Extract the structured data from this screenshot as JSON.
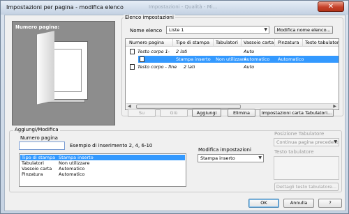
{
  "window": {
    "title": "Impostazioni per pagina - modifica elenco",
    "background_title": "Impostazioni - Qualità - Mi...",
    "close_glyph": "✕"
  },
  "preview": {
    "label": "Numero pagina:"
  },
  "elenco": {
    "group_label": "Elenco impostazioni",
    "nome_label": "Nome elenco",
    "nome_value": "Liste 1",
    "modifica_nome_button": "Modifica nome elenco...",
    "columns": [
      "Numero pagina",
      "Tipo di stampa",
      "Tabulatori",
      "Vassoio carta",
      "Pinzatura",
      "Testo tabulatore"
    ],
    "rows": [
      {
        "numero": "Testo corpo 1-",
        "tipo": "2 lati",
        "tab": "",
        "vassoio": "Auto",
        "pinz": "",
        "testo": "",
        "italic": true,
        "selected": false,
        "indent": 0
      },
      {
        "numero": "",
        "tipo": "Stampa inserto",
        "tab": "Non utilizzare",
        "vassoio": "Automatico",
        "pinz": "Automatico",
        "testo": "",
        "italic": false,
        "selected": true,
        "indent": 1
      },
      {
        "numero": "Testo corpo - fine",
        "tipo": "2 lati",
        "tab": "",
        "vassoio": "Auto",
        "pinz": "",
        "testo": "",
        "italic": true,
        "selected": false,
        "indent": 0
      }
    ]
  },
  "buttons": {
    "su": "Su",
    "giu": "Giù",
    "aggiungi": "Aggiungi",
    "elimina": "Elimina",
    "impostazioni_tab": "Impostazioni carta Tabulatori..."
  },
  "aggiungi": {
    "group_label": "Aggiungi/Modifica",
    "numero_label": "Numero pagina",
    "numero_value": "",
    "esempio": "Esempio di inserimento 2, 4, 6-10",
    "list": [
      {
        "key": "Tipo di stampa",
        "value": "Stampa inserto",
        "selected": true
      },
      {
        "key": "Tabulatori",
        "value": "Non utilizzare",
        "selected": false
      },
      {
        "key": "Vassoio carta",
        "value": "Automatico",
        "selected": false
      },
      {
        "key": "Pinzatura",
        "value": "Automatico",
        "selected": false
      }
    ],
    "modifica_label": "Modifica impostazioni",
    "modifica_value": "Stampa inserto",
    "posizione_label": "Posizione Tabulatore",
    "posizione_value": "Continua pagina precedente",
    "testo_label": "Testo tabulatore",
    "dettagli_button": "Dettagli testo tabulatore..."
  },
  "footer": {
    "ok": "OK",
    "annulla": "Annulla",
    "help": "?"
  }
}
